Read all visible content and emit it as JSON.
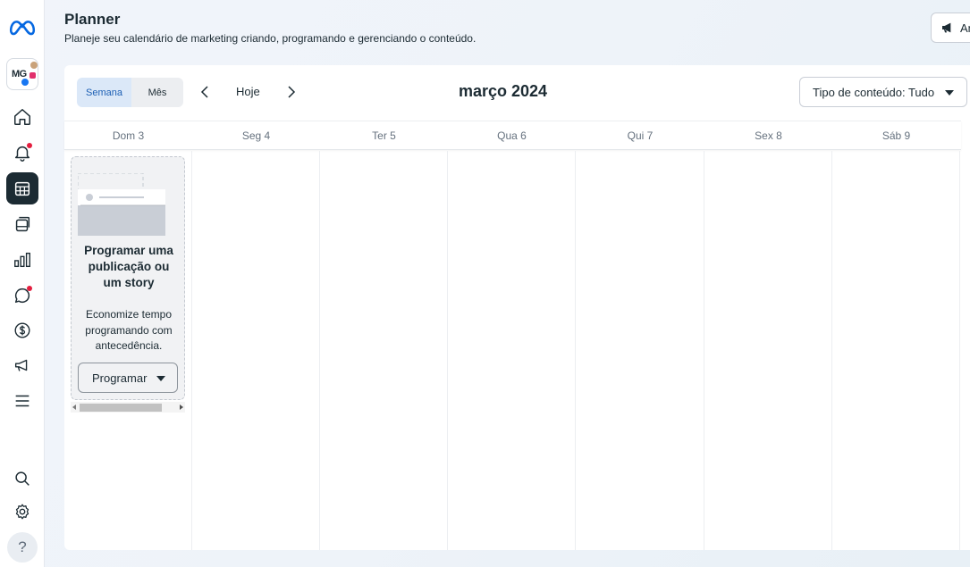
{
  "header": {
    "title": "Planner",
    "subtitle": "Planeje seu calendário de marketing criando, programando e gerenciando o conteúdo.",
    "ad_button_label": "An"
  },
  "sidebar": {
    "avatar_initials": "MG",
    "items": [
      {
        "name": "home",
        "icon": "home-icon",
        "badge": false
      },
      {
        "name": "notifications",
        "icon": "bell-icon",
        "badge": true
      },
      {
        "name": "planner",
        "icon": "calendar-icon",
        "badge": false,
        "active": true
      },
      {
        "name": "content",
        "icon": "content-stack-icon",
        "badge": false
      },
      {
        "name": "insights",
        "icon": "bar-chart-icon",
        "badge": false
      },
      {
        "name": "inbox",
        "icon": "chat-bubble-icon",
        "badge": true
      },
      {
        "name": "monetization",
        "icon": "dollar-icon",
        "badge": false
      },
      {
        "name": "ads",
        "icon": "megaphone-icon",
        "badge": false
      },
      {
        "name": "menu",
        "icon": "menu-icon",
        "badge": false
      }
    ],
    "bottom": [
      {
        "name": "search",
        "icon": "search-icon"
      },
      {
        "name": "settings",
        "icon": "gear-icon"
      },
      {
        "name": "help",
        "icon": "help-icon",
        "label": "?"
      }
    ]
  },
  "toolbar": {
    "view_week": "Semana",
    "view_month": "Mês",
    "active_view": "Semana",
    "today_label": "Hoje",
    "month_title": "março 2024",
    "filter_label": "Tipo de conteúdo: Tudo"
  },
  "days": [
    "Dom 3",
    "Seg 4",
    "Ter 5",
    "Qua 6",
    "Qui 7",
    "Sex 8",
    "Sáb 9"
  ],
  "empty_state": {
    "title": "Programar uma publicação ou um story",
    "description": "Economize tempo programando com antecedência.",
    "button_label": "Programar"
  },
  "colors": {
    "accent": "#1c5fb4",
    "active_segment_bg": "#dbe8f8",
    "badge": "#e41e3f",
    "meta_blue": "#0668e1"
  }
}
